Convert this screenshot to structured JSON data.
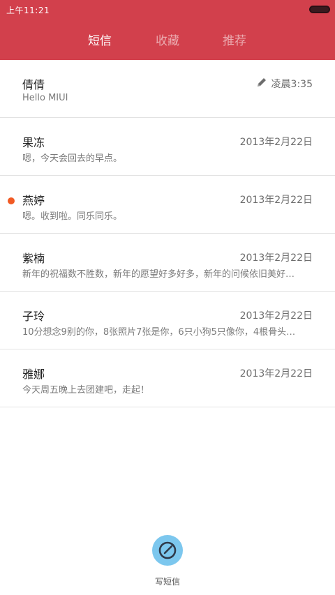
{
  "status": {
    "time": "上午11:21"
  },
  "tabs": [
    {
      "label": "短信"
    },
    {
      "label": "收藏"
    },
    {
      "label": "推荐"
    }
  ],
  "messages": [
    {
      "name": "倩倩",
      "preview": "Hello MIUI",
      "date": "凌晨3:35",
      "draft": true,
      "unread": false
    },
    {
      "name": "果冻",
      "preview": "嗯，今天会回去的早点。",
      "date": "2013年2月22日",
      "draft": false,
      "unread": false
    },
    {
      "name": "燕婷",
      "preview": "嗯。收到啦。同乐同乐。",
      "date": "2013年2月22日",
      "draft": false,
      "unread": true
    },
    {
      "name": "紫楠",
      "preview": "新年的祝福数不胜数，新年的愿望好多好多，新年的问候依旧美好…",
      "date": "2013年2月22日",
      "draft": false,
      "unread": false
    },
    {
      "name": "子玲",
      "preview": "10分想念9别的你，8张照片7张是你，6只小狗5只像你，4根骨头…",
      "date": "2013年2月22日",
      "draft": false,
      "unread": false
    },
    {
      "name": "雅娜",
      "preview": "今天周五晚上去团建吧，走起！",
      "date": "2013年2月22日",
      "draft": false,
      "unread": false
    }
  ],
  "compose": {
    "label": "写短信",
    "icon": "compose-icon"
  },
  "colors": {
    "header": "#d2404c",
    "unread": "#f15a24",
    "compose": "#7cc7ee"
  }
}
